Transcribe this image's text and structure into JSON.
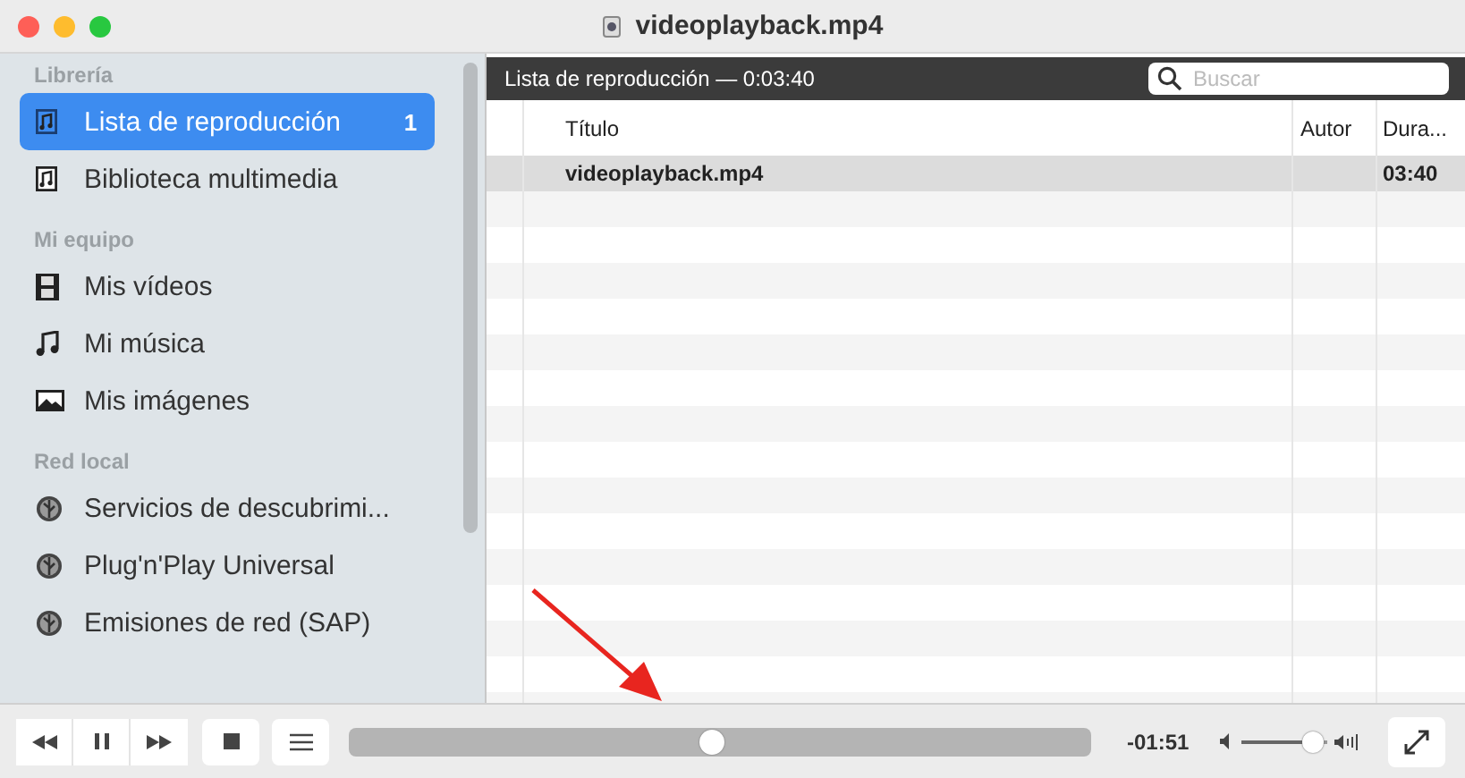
{
  "window": {
    "title": "videoplayback.mp4"
  },
  "sidebar": {
    "sections": [
      {
        "heading": "Librería",
        "items": [
          {
            "label": "Lista de reproducción",
            "badge": "1",
            "selected": true,
            "kind": "playlist"
          },
          {
            "label": "Biblioteca multimedia",
            "selected": false,
            "kind": "playlist"
          }
        ]
      },
      {
        "heading": "Mi equipo",
        "items": [
          {
            "label": "Mis vídeos",
            "selected": false,
            "kind": "film"
          },
          {
            "label": "Mi música",
            "selected": false,
            "kind": "music"
          },
          {
            "label": "Mis imágenes",
            "selected": false,
            "kind": "picture"
          }
        ]
      },
      {
        "heading": "Red local",
        "items": [
          {
            "label": "Servicios de descubrimi...",
            "selected": false,
            "kind": "network"
          },
          {
            "label": "Plug'n'Play Universal",
            "selected": false,
            "kind": "network"
          },
          {
            "label": "Emisiones de red (SAP)",
            "selected": false,
            "kind": "network"
          }
        ]
      }
    ]
  },
  "playlist": {
    "header": "Lista de reproducción — 0:03:40",
    "search": {
      "placeholder": "Buscar"
    },
    "columns": [
      "Título",
      "Autor",
      "Dura..."
    ],
    "rows": [
      {
        "title": "videoplayback.mp4",
        "duration": "03:40",
        "selected": true
      }
    ]
  },
  "controls": {
    "seek": {
      "level": 0.49
    },
    "remaining": "-01:51",
    "volume": {
      "level": 0.83
    }
  }
}
